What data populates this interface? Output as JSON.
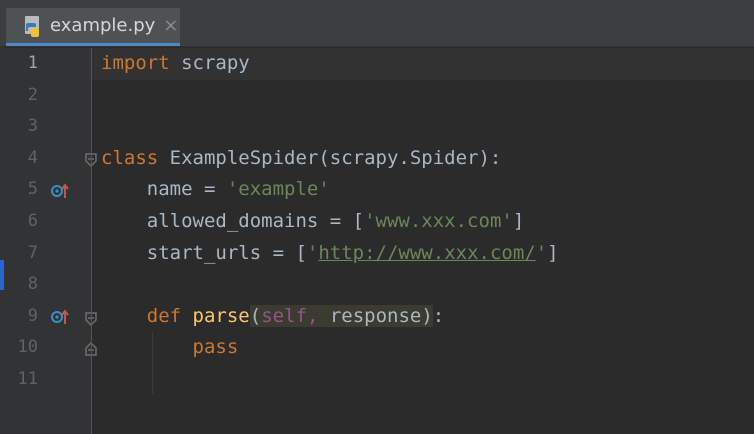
{
  "tab": {
    "filename": "example.py",
    "close_glyph": "×",
    "icon": "python-file-icon"
  },
  "colors": {
    "background": "#2b2b2b",
    "keyword": "#cc7832",
    "string": "#6a8759",
    "function": "#ffc66d",
    "self": "#94558d",
    "text": "#a9b7c6"
  },
  "gutter": {
    "line_numbers": [
      "1",
      "2",
      "3",
      "4",
      "5",
      "6",
      "7",
      "8",
      "9",
      "10",
      "11"
    ],
    "override_markers": [
      "5",
      "9"
    ]
  },
  "code": {
    "l1": {
      "kw": "import",
      "rest": " scrapy"
    },
    "l4": {
      "kw": "class",
      "rest": " ExampleSpider(scrapy.Spider):"
    },
    "l5": {
      "a": "    name = ",
      "s": "'example'"
    },
    "l6": {
      "a": "    allowed_domains = [",
      "s": "'www.xxx.com'",
      "b": "]"
    },
    "l7": {
      "a": "    start_urls = [",
      "q1": "'",
      "url": "http://www.xxx.com/",
      "q2": "'",
      "b": "]"
    },
    "l9": {
      "pad": "    ",
      "kw": "def",
      "sp": " ",
      "fn": "parse",
      "op": "(",
      "self": "self,",
      "param": " response)",
      "end": ":"
    },
    "l10": {
      "pad": "        ",
      "kw": "pass"
    }
  }
}
